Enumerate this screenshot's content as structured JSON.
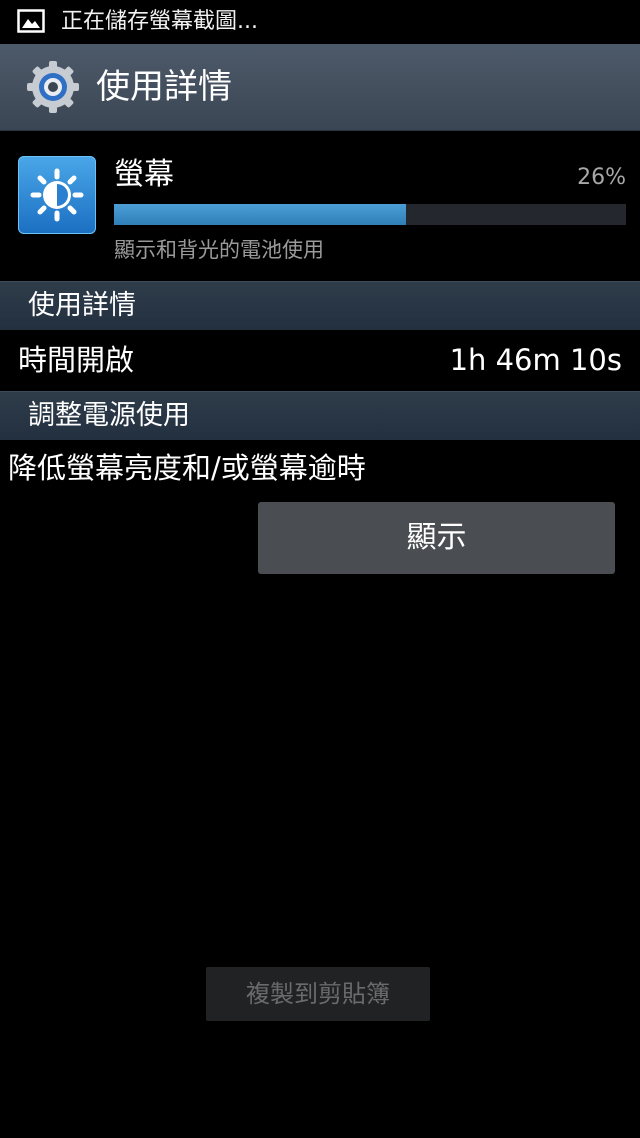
{
  "status_bar": {
    "notification_icon": "picture-icon",
    "notification_text": "正在儲存螢幕截圖..."
  },
  "action_bar": {
    "icon": "gear-icon",
    "title": "使用詳情"
  },
  "app_item": {
    "icon": "brightness-icon",
    "name": "螢幕",
    "percent_label": "26%",
    "usage_fraction": 0.57,
    "description": "顯示和背光的電池使用"
  },
  "sections": {
    "usage_details": "使用詳情",
    "adjust_power": "調整電源使用"
  },
  "details": {
    "time_on_label": "時間開啟",
    "time_on_value": "1h 46m 10s"
  },
  "tip": {
    "text": "降低螢幕亮度和/或螢幕逾時",
    "button_label": "顯示"
  },
  "copy_button_label": "複製到剪貼簿",
  "colors": {
    "accent_bar": "#3c8ecb",
    "action_bar": "#46525f",
    "section_header": "#2a3644"
  }
}
